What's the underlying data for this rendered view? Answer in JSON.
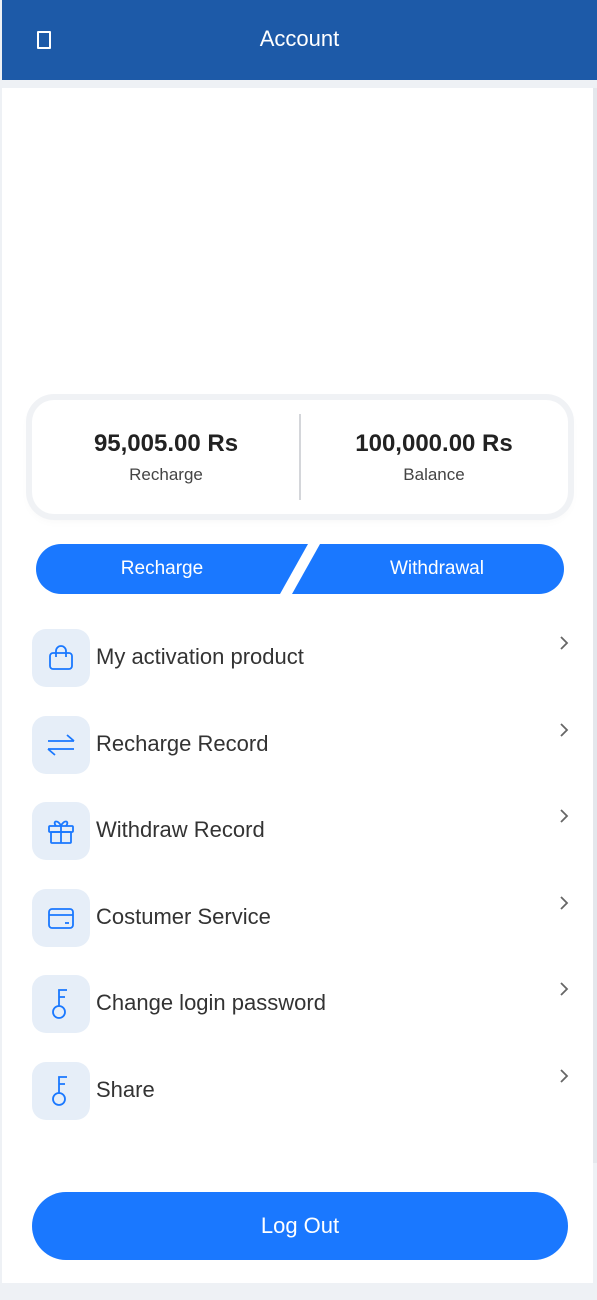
{
  "header": {
    "title": "Account"
  },
  "stats": {
    "recharge": {
      "amount": "95,005.00 Rs",
      "label": "Recharge"
    },
    "balance": {
      "amount": "100,000.00 Rs",
      "label": "Balance"
    }
  },
  "actions": {
    "recharge_label": "Recharge",
    "withdrawal_label": "Withdrawal"
  },
  "menu": [
    {
      "label": "My activation product",
      "icon": "bag-icon"
    },
    {
      "label": "Recharge Record",
      "icon": "transfer-arrows-icon"
    },
    {
      "label": "Withdraw Record",
      "icon": "gift-icon"
    },
    {
      "label": "Costumer Service",
      "icon": "card-icon"
    },
    {
      "label": "Change login password",
      "icon": "key-icon"
    },
    {
      "label": "Share",
      "icon": "key-icon"
    }
  ],
  "logout_label": "Log Out",
  "colors": {
    "header": "#1d5aa8",
    "accent": "#1a78ff",
    "icon_bg": "#e6eef8"
  }
}
